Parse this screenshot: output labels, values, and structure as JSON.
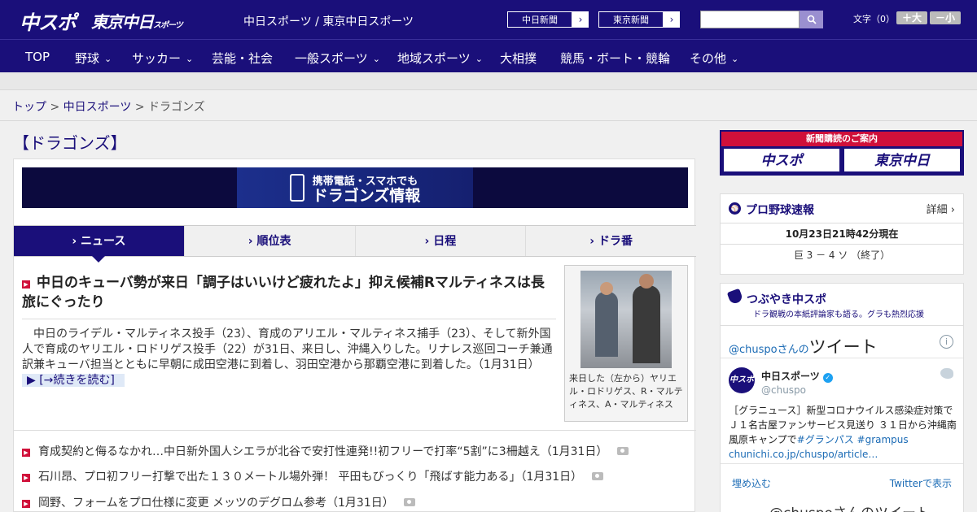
{
  "header": {
    "logo": "中スポ",
    "logo2": "東京中日",
    "logo2_small": "スポーツ",
    "site_links": "中日スポーツ / 東京中日スポーツ",
    "paper_btn1": "中日新聞",
    "paper_btn2": "東京新聞",
    "arrow": "›",
    "search_placeholder": "",
    "fontsize_label": "文字（0）",
    "fs_up": "＋大",
    "fs_down": "－小"
  },
  "nav": {
    "items": [
      {
        "label": "TOP",
        "chev": ""
      },
      {
        "label": "野球",
        "chev": "⌄"
      },
      {
        "label": "サッカー",
        "chev": "⌄"
      },
      {
        "label": "芸能・社会",
        "chev": ""
      },
      {
        "label": "一般スポーツ",
        "chev": "⌄"
      },
      {
        "label": "地域スポーツ",
        "chev": "⌄"
      },
      {
        "label": "大相撲",
        "chev": ""
      },
      {
        "label": "競馬・ボート・競輪",
        "chev": ""
      },
      {
        "label": "その他",
        "chev": "⌄"
      }
    ]
  },
  "breadcrumb": {
    "top": "トップ",
    "sep": " > ",
    "chunichi": "中日スポーツ",
    "current": "ドラゴンズ"
  },
  "page_heading": "【ドラゴンズ】",
  "banner": {
    "line1": "携帯電話・スマホでも",
    "line2": "ドラゴンズ情報"
  },
  "tabs": [
    {
      "label": "› ニュース"
    },
    {
      "label": "› 順位表"
    },
    {
      "label": "› 日程"
    },
    {
      "label": "› ドラ番"
    }
  ],
  "lead": {
    "title": "中日のキューバ勢が来日「調子はいいけど疲れたよ」抑え候補Rマルティネスは長旅にぐったり",
    "body": "中日のライデル・マルティネス投手（23）、育成のアリエル・マルティネス捕手（23）、そして新外国人で育成のヤリエル・ロドリゲス投手（22）が31日、来日し、沖縄入りした。リナレス巡回コーチ兼通訳兼キューバ担当とともに早朝に成田空港に到着し、羽田空港から那覇空港に到着した。（1月31日）",
    "readmore": "▶ [→続きを読む]",
    "caption": "来日した（左から）ヤリエル・ロドリゲス、R・マルティネス、A・マルティネス"
  },
  "news": [
    {
      "text": "育成契約と侮るなかれ…中日新外国人シエラが北谷で安打性連発!!初フリーで打率“5割”に3柵越え（1月31日）"
    },
    {
      "text": "石川昂、プロ初フリー打撃で出た１３０メートル場外弾！ 平田もびっくり「飛ばす能力ある」（1月31日）"
    },
    {
      "text": "岡野、フォームをプロ仕様に変更 メッツのデグロム参考（1月31日）"
    }
  ],
  "sidebar": {
    "subscription": {
      "title": "新聞購読のご案内",
      "btn1": "中スポ",
      "btn2": "東京中日"
    },
    "scores": {
      "title": "プロ野球速報",
      "link": "詳細 ›",
      "time": "10月23日21時42分現在",
      "row": "巨 3 － 4 ソ （終了）"
    },
    "tweets": {
      "title": "つぶやき中スポ",
      "subtitle": "ドラ観戦の本紙評論家も語る。グラも熱烈応援",
      "handle": "@chuspo",
      "handle_suffix": "さんの",
      "handle_big": "ツイート",
      "info": "i",
      "avatar_text": "中スポ",
      "name": "中日スポーツ",
      "verified": "✓",
      "screen_name": "@chuspo",
      "text_main": "［グラニュース］新型コロナウイルス感染症対策でＪ１名古屋ファンサービス見送り ３１日から沖縄南風原キャンプで",
      "text_tags": "#グランパス #grampus",
      "text_link": "chunichi.co.jp/chuspo/article…",
      "embed": "埋め込む",
      "view": "Twitterで表示",
      "next": "@chuspoさんのツイート"
    }
  },
  "colors": {
    "brand": "#1a0f7a",
    "accent_red": "#d0103a",
    "link_blue": "#1b6bb5"
  }
}
